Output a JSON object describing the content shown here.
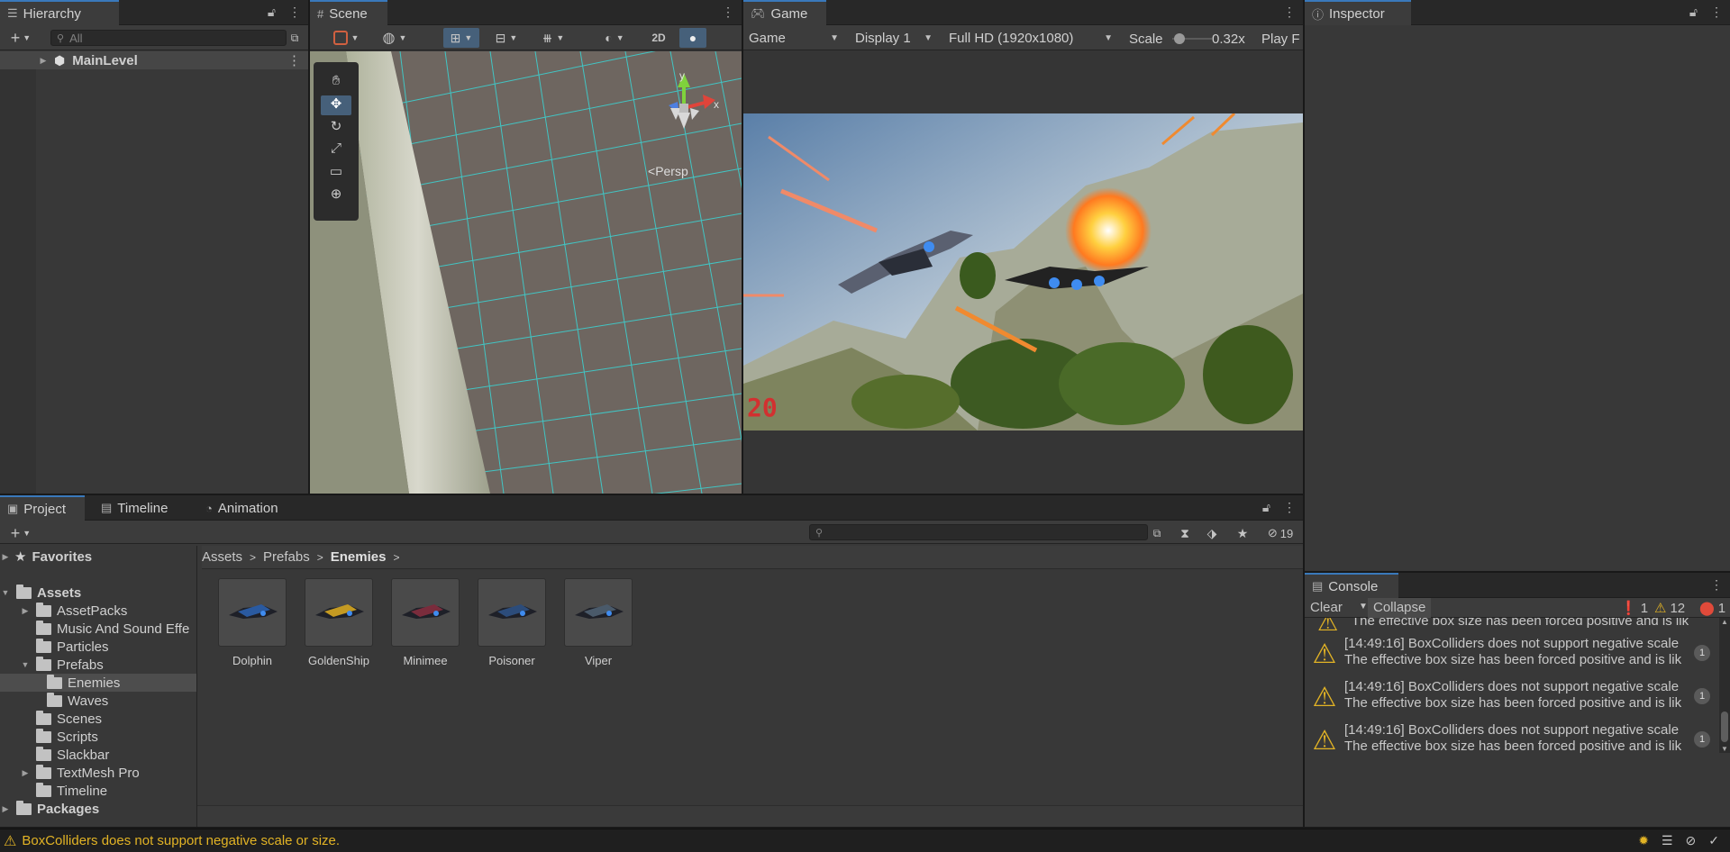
{
  "hierarchy": {
    "tab_label": "Hierarchy",
    "search_placeholder": "All",
    "root_item": "MainLevel"
  },
  "scene": {
    "tab_label": "Scene",
    "btn_2d": "2D",
    "persp_label": "Persp",
    "gizmo_y": "y",
    "gizmo_x": "x"
  },
  "game": {
    "tab_label": "Game",
    "view_dropdown": "Game",
    "display_dropdown": "Display 1",
    "resolution_dropdown": "Full HD (1920x1080)",
    "scale_label": "Scale",
    "scale_value": 0.32,
    "scale_value_text": "0.32x",
    "play_focused": "Play F",
    "fps_overlay": "20"
  },
  "inspector": {
    "tab_label": "Inspector"
  },
  "bottom_tabs": [
    {
      "label": "Project"
    },
    {
      "label": "Timeline"
    },
    {
      "label": "Animation"
    }
  ],
  "project": {
    "hidden_count": "19",
    "breadcrumb": [
      "Assets",
      "Prefabs",
      "Enemies"
    ],
    "favorites_label": "Favorites",
    "tree": {
      "assets": "Assets",
      "asset_packs": "AssetPacks",
      "music": "Music And Sound Effe",
      "particles": "Particles",
      "prefabs": "Prefabs",
      "enemies": "Enemies",
      "waves": "Waves",
      "scenes": "Scenes",
      "scripts": "Scripts",
      "slackbar": "Slackbar",
      "textmesh": "TextMesh Pro",
      "timeline": "Timeline",
      "packages": "Packages"
    },
    "assets": [
      {
        "name": "Dolphin",
        "color": "#2a5aa0"
      },
      {
        "name": "GoldenShip",
        "color": "#c49a22"
      },
      {
        "name": "Minimee",
        "color": "#7a2c3c"
      },
      {
        "name": "Poisoner",
        "color": "#2c4c7a"
      },
      {
        "name": "Viper",
        "color": "#4a5a6a"
      }
    ]
  },
  "console": {
    "tab_label": "Console",
    "clear_label": "Clear",
    "collapse_label": "Collapse",
    "info_count": "1",
    "warn_count": "12",
    "error_count": "1",
    "partial_line": "The effective box size has been forced positive and is lik",
    "entries": [
      {
        "line1": "[14:49:16] BoxColliders does not support negative scale",
        "line2": "The effective box size has been forced positive and is lik",
        "count": "1"
      },
      {
        "line1": "[14:49:16] BoxColliders does not support negative scale",
        "line2": "The effective box size has been forced positive and is lik",
        "count": "1"
      },
      {
        "line1": "[14:49:16] BoxColliders does not support negative scale",
        "line2": "The effective box size has been forced positive and is lik",
        "count": "1"
      }
    ]
  },
  "status": {
    "message": "BoxColliders does not support negative scale or size.",
    "warn_color": "#e2b325"
  }
}
